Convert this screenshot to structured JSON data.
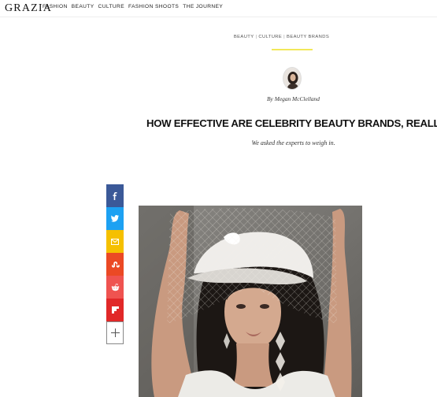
{
  "header": {
    "logo": "GRAZIA",
    "nav": [
      "FASHION",
      "BEAUTY",
      "CULTURE",
      "FASHION SHOOTS",
      "THE JOURNEY"
    ]
  },
  "breadcrumb": {
    "items": [
      "BEAUTY",
      "CULTURE",
      "BEAUTY BRANDS"
    ],
    "separator": "|"
  },
  "author": {
    "byline": "By Megan McClelland"
  },
  "article": {
    "headline": "HOW EFFECTIVE ARE CELEBRITY BEAUTY BRANDS, REALLY?",
    "standfirst": "We asked the experts to weigh in."
  },
  "share": {
    "buttons": [
      {
        "icon": "facebook-icon",
        "color": "#3b5998"
      },
      {
        "icon": "twitter-icon",
        "color": "#1da1f2"
      },
      {
        "icon": "email-icon",
        "color": "#f5c000"
      },
      {
        "icon": "stumbleupon-icon",
        "color": "#eb4924"
      },
      {
        "icon": "reddit-icon",
        "color": "#ef5350"
      },
      {
        "icon": "flipboard-icon",
        "color": "#e12828"
      }
    ],
    "more_icon": "plus-icon"
  },
  "colors": {
    "accent": "#f2e85a"
  }
}
